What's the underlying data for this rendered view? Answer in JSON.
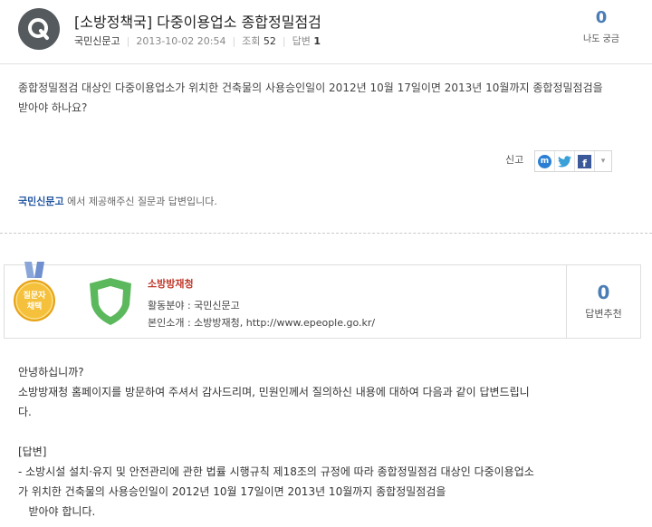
{
  "question": {
    "badge": "Q",
    "title": "[소방정책국] 다중이용업소 종합정밀점검",
    "author": "국민신문고",
    "date": "2013-10-02 20:54",
    "views_label": "조회",
    "views": "52",
    "answers_label": "답변",
    "answers": "1",
    "curious_count": "0",
    "curious_label": "나도 궁금",
    "body_line1": "종합정밀점검 대상인 다중이용업소가 위치한 건축물의 사용승인일이 2012년 10월 17일이면 2013년 10월까지 종합정밀점검을",
    "body_line2": "받아야 하나요?",
    "report_label": "신고",
    "provided_source": "국민신문고",
    "provided_text": " 에서 제공해주신 질문과 답변입니다."
  },
  "share": {
    "icons": [
      "me2day-icon",
      "twitter-icon",
      "facebook-icon",
      "more-dropdown-icon"
    ],
    "me2day_glyph": "m",
    "facebook_glyph": "f",
    "more_glyph": "▾"
  },
  "answerer": {
    "medal_text1": "질문자",
    "medal_text2": "채택",
    "name": "소방방재청",
    "field_line": "활동분야 : 국민신문고",
    "intro_line": "본인소개 : 소방방재청, http://www.epeople.go.kr/",
    "recommend_count": "0",
    "recommend_label": "답변추천",
    "colors": {
      "name": "#c0392b",
      "accent": "#4a7db5",
      "shield": "#5cb85c",
      "medal": "#f0b429"
    }
  },
  "answer": {
    "lines": [
      "안녕하십니까?",
      "소방방재청 홈페이지를 방문하여 주셔서 감사드리며, 민원인께서 질의하신 내용에 대하여 다음과 같이 답변드립니",
      "다.",
      "",
      "[답변]",
      "- 소방시설 설치·유지 및 안전관리에 관한 법률 시행규칙 제18조의 규정에 따라 종합정밀점검 대상인 다중이용업소",
      "가 위치한 건축물의 사용승인일이 2012년 10월 17일이면 2013년 10월까지 종합정밀점검을",
      "   받아야 합니다."
    ]
  }
}
